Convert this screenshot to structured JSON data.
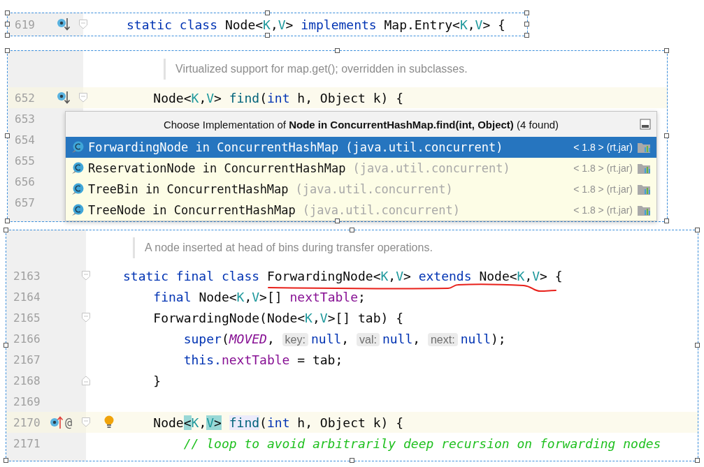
{
  "panels": [
    {
      "lines": [
        {
          "number": "619",
          "markers": [
            {
              "kind": "implemented"
            }
          ],
          "fold": {
            "kind": "start"
          },
          "highlighted": false,
          "bulb": false,
          "tokens": [
            {
              "text": "static class",
              "kind": "keyword"
            },
            {
              "text": " Node<",
              "kind": "plain"
            },
            {
              "text": "K",
              "kind": "type"
            },
            {
              "text": ",",
              "kind": "plain"
            },
            {
              "text": "V",
              "kind": "type"
            },
            {
              "text": "> ",
              "kind": "plain"
            },
            {
              "text": "implements",
              "kind": "keyword"
            },
            {
              "text": " Map.Entry<",
              "kind": "plain"
            },
            {
              "text": "K",
              "kind": "type"
            },
            {
              "text": ",",
              "kind": "plain"
            },
            {
              "text": "V",
              "kind": "type"
            },
            {
              "text": "> {",
              "kind": "plain"
            }
          ]
        }
      ]
    },
    {
      "doc": "Virtualized support for map.get(); overridden in subclasses.",
      "lines": [
        {
          "number": "652",
          "markers": [
            {
              "kind": "implemented"
            }
          ],
          "fold": {
            "kind": "start"
          },
          "highlighted": true,
          "bulb": false,
          "tokens": [
            {
              "text": "    Node<",
              "kind": "plain"
            },
            {
              "text": "K",
              "kind": "type"
            },
            {
              "text": ",",
              "kind": "plain"
            },
            {
              "text": "V",
              "kind": "type"
            },
            {
              "text": "> ",
              "kind": "plain"
            },
            {
              "text": "find",
              "kind": "method"
            },
            {
              "text": "(",
              "kind": "plain"
            },
            {
              "text": "int",
              "kind": "keyword"
            },
            {
              "text": " h, Object k) {",
              "kind": "plain"
            }
          ]
        },
        {
          "number": "653",
          "highlighted": false,
          "bulb": false
        },
        {
          "number": "654",
          "highlighted": false,
          "bulb": false
        },
        {
          "number": "655",
          "highlighted": false,
          "bulb": false
        },
        {
          "number": "656",
          "highlighted": false,
          "bulb": false
        },
        {
          "number": "657",
          "highlighted": false,
          "bulb": false
        }
      ],
      "popup": {
        "title": "Choose Implementation of **Node in ConcurrentHashMap.find(int, Object)** (4 found)",
        "items": [
          {
            "name": "ForwardingNode in ConcurrentHashMap",
            "package": "(java.util.concurrent)",
            "location": "< 1.8 > (rt.jar)",
            "selected": true
          },
          {
            "name": "ReservationNode in ConcurrentHashMap",
            "package": "(java.util.concurrent)",
            "location": "< 1.8 > (rt.jar)",
            "selected": false
          },
          {
            "name": "TreeBin in ConcurrentHashMap",
            "package": "(java.util.concurrent)",
            "location": "< 1.8 > (rt.jar)",
            "selected": false
          },
          {
            "name": "TreeNode in ConcurrentHashMap",
            "package": "(java.util.concurrent)",
            "location": "< 1.8 > (rt.jar)",
            "selected": false
          }
        ]
      }
    },
    {
      "doc": "A node inserted at head of bins during transfer operations.",
      "underline": true,
      "lines": [
        {
          "number": "2163",
          "fold": {
            "kind": "start"
          },
          "highlighted": false,
          "bulb": false,
          "tokens": [
            {
              "text": "static final class",
              "kind": "keyword"
            },
            {
              "text": " ForwardingNode<",
              "kind": "plain"
            },
            {
              "text": "K",
              "kind": "type"
            },
            {
              "text": ",",
              "kind": "plain"
            },
            {
              "text": "V",
              "kind": "type"
            },
            {
              "text": "> ",
              "kind": "plain"
            },
            {
              "text": "extends",
              "kind": "keyword"
            },
            {
              "text": " Node<",
              "kind": "plain"
            },
            {
              "text": "K",
              "kind": "type"
            },
            {
              "text": ",",
              "kind": "plain"
            },
            {
              "text": "V",
              "kind": "type"
            },
            {
              "text": "> {",
              "kind": "plain"
            }
          ]
        },
        {
          "number": "2164",
          "highlighted": false,
          "bulb": false,
          "tokens": [
            {
              "text": "    final",
              "kind": "keyword"
            },
            {
              "text": " Node<",
              "kind": "plain"
            },
            {
              "text": "K",
              "kind": "type"
            },
            {
              "text": ",",
              "kind": "plain"
            },
            {
              "text": "V",
              "kind": "type"
            },
            {
              "text": ">[] ",
              "kind": "plain"
            },
            {
              "text": "nextTable",
              "kind": "field"
            },
            {
              "text": ";",
              "kind": "plain"
            }
          ]
        },
        {
          "number": "2165",
          "fold": {
            "kind": "start"
          },
          "highlighted": false,
          "bulb": false,
          "tokens": [
            {
              "text": "    ForwardingNode(Node<",
              "kind": "plain"
            },
            {
              "text": "K",
              "kind": "type"
            },
            {
              "text": ",",
              "kind": "plain"
            },
            {
              "text": "V",
              "kind": "type"
            },
            {
              "text": ">[] tab) {",
              "kind": "plain"
            }
          ]
        },
        {
          "number": "2166",
          "highlighted": false,
          "bulb": false,
          "tokens": [
            {
              "text": "        super",
              "kind": "keyword"
            },
            {
              "text": "(",
              "kind": "plain"
            },
            {
              "text": "MOVED",
              "kind": "constant"
            },
            {
              "text": ", ",
              "kind": "plain"
            },
            {
              "text": "key:",
              "kind": "hint"
            },
            {
              "text": "null",
              "kind": "keyword"
            },
            {
              "text": ", ",
              "kind": "plain"
            },
            {
              "text": "val:",
              "kind": "hint"
            },
            {
              "text": "null",
              "kind": "keyword"
            },
            {
              "text": ", ",
              "kind": "plain"
            },
            {
              "text": "next:",
              "kind": "hint"
            },
            {
              "text": "null",
              "kind": "keyword"
            },
            {
              "text": ");",
              "kind": "plain"
            }
          ]
        },
        {
          "number": "2167",
          "highlighted": false,
          "bulb": false,
          "tokens": [
            {
              "text": "        this.",
              "kind": "keyword"
            },
            {
              "text": "nextTable",
              "kind": "field"
            },
            {
              "text": " = tab;",
              "kind": "plain"
            }
          ]
        },
        {
          "number": "2168",
          "fold": {
            "kind": "end"
          },
          "highlighted": false,
          "bulb": false,
          "tokens": [
            {
              "text": "    }",
              "kind": "plain"
            }
          ]
        },
        {
          "number": "2169",
          "highlighted": false,
          "bulb": false
        },
        {
          "number": "2170",
          "markers": [
            {
              "kind": "overriding"
            },
            {
              "kind": "symbol",
              "text": "@"
            }
          ],
          "fold": {
            "kind": "start"
          },
          "highlighted": true,
          "bulb": true,
          "tokens": [
            {
              "text": "    Node",
              "kind": "plain"
            },
            {
              "text": "<",
              "kind": "plain",
              "brace_match": true
            },
            {
              "text": "K",
              "kind": "type"
            },
            {
              "text": ",",
              "kind": "plain"
            },
            {
              "text": "V",
              "kind": "type",
              "brace_match": true
            },
            {
              "text": ">",
              "kind": "plain",
              "brace_match": true
            },
            {
              "text": " find",
              "kind": "method",
              "usage_highlight": true
            },
            {
              "text": "(",
              "kind": "plain"
            },
            {
              "text": "int",
              "kind": "keyword"
            },
            {
              "text": " h, Object k) {",
              "kind": "plain"
            }
          ]
        },
        {
          "number": "2171",
          "highlighted": false,
          "bulb": false,
          "tokens": [
            {
              "text": "        // loop to avoid arbitrarily deep recursion on forwarding nodes",
              "kind": "comment"
            }
          ]
        }
      ]
    }
  ]
}
